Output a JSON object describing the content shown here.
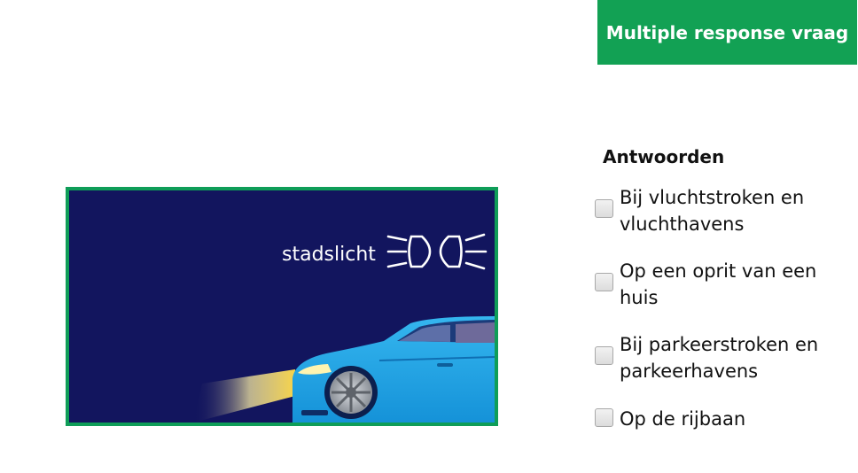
{
  "header": {
    "badge_label": "Multiple response vraag"
  },
  "question_image": {
    "caption": "stadslicht",
    "icon": "parking-light-icon",
    "colors": {
      "background": "#12155e",
      "border": "#0f9d58",
      "car": "#1ea7e8"
    }
  },
  "answers": {
    "heading": "Antwoorden",
    "options": [
      {
        "label": "Bij vluchtstroken en vluchthavens",
        "checked": false
      },
      {
        "label": "Op een oprit van een huis",
        "checked": false
      },
      {
        "label": "Bij parkeerstroken en parkeerhavens",
        "checked": false
      },
      {
        "label": "Op de rijbaan",
        "checked": false
      }
    ]
  },
  "colors": {
    "accent": "#12a154"
  }
}
